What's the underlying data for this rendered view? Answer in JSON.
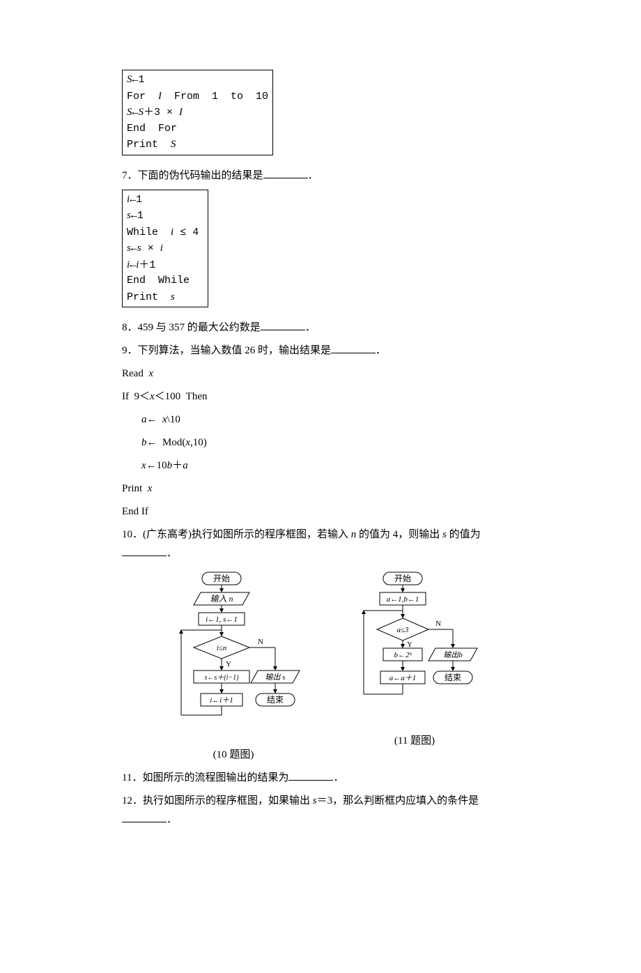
{
  "codebox1": {
    "l1": "S←1",
    "l2": "For  I  From  1  to  10",
    "l3": "S←S＋3 × I",
    "l4": "End  For",
    "l5": "Print  S"
  },
  "q7": "7．下面的伪代码输出的结果是",
  "codebox2": {
    "l1": "i←1",
    "l2": "s←1",
    "l3": "While  i ≤ 4",
    "l4": "s←s × i",
    "l5": "i←i＋1",
    "l6": "End  While",
    "l7": "Print  s"
  },
  "q8": "8．459 与 357 的最大公约数是",
  "q9": "9．下列算法，当输入数值 26 时，输出结果是",
  "alg9": {
    "l1": "Read  x",
    "l2": "If  9＜x＜100  Then",
    "l3": "a←  x\\10",
    "l4": "b←  Mod(x,10)",
    "l5": "x←10b＋a",
    "l6": "Print  x",
    "l7": "End  If"
  },
  "q10": "10．(广东高考)执行如图所示的程序框图，若输入 n 的值为 4，则输出 s 的值为",
  "q11": "11．如图所示的流程图输出的结果为",
  "q12": "12．执行如图所示的程序框图，如果输出 s＝3，那么判断框内应填入的条件是",
  "fig10": {
    "caption": "(10 题图)",
    "nodes": {
      "start": "开始",
      "input": "输入 n",
      "init": "i←1, s←1",
      "cond": "i≤n",
      "assign_s": "s←s＋(i−1)",
      "assign_i": "i←i＋1",
      "output": "输出 s",
      "end": "结束",
      "yes": "Y",
      "no": "N"
    }
  },
  "fig11": {
    "caption": "(11 题图)",
    "nodes": {
      "start": "开始",
      "init": "a←1,b←1",
      "cond": "a≤3",
      "assign_b": "b←2ᵇ",
      "assign_a": "a←a＋1",
      "output": "输出b",
      "end": "结束",
      "yes": "Y",
      "no": "N"
    }
  },
  "period": "．"
}
